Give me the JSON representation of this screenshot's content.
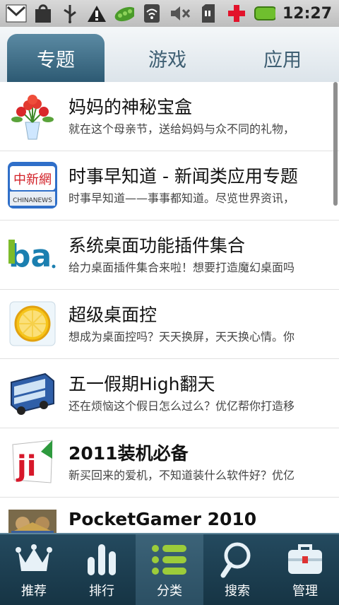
{
  "status": {
    "time": "12:27",
    "icons": [
      "gmail-icon",
      "bag-icon",
      "usb-icon",
      "warning-icon",
      "pea-pod-icon",
      "wifi-icon",
      "mute-icon",
      "sd-card-icon",
      "plus-icon",
      "battery-icon"
    ]
  },
  "tabs": [
    {
      "label": "专题",
      "active": true
    },
    {
      "label": "游戏",
      "active": false
    },
    {
      "label": "应用",
      "active": false
    }
  ],
  "items": [
    {
      "title": "妈妈的神秘宝盒",
      "desc": "就在这个母亲节，送给妈妈与众不同的礼物，",
      "icon": "flowers-icon",
      "bold": false
    },
    {
      "title": "时事早知道 - 新闻类应用专题",
      "desc": "时事早知道——事事都知道。尽览世界资讯，",
      "icon": "chinanews-icon",
      "bold": false
    },
    {
      "title": "系统桌面功能插件集合",
      "desc": "给力桌面插件集合来啦！想要打造魔幻桌面吗",
      "icon": "ba-icon",
      "bold": false
    },
    {
      "title": "超级桌面控",
      "desc": "想成为桌面控吗？天天换屏，天天换心情。你",
      "icon": "lemon-ice-icon",
      "bold": false
    },
    {
      "title": "五一假期High翻天",
      "desc": "还在烦恼这个假日怎么过么？优亿帮你打造移",
      "icon": "bus-icon",
      "bold": false
    },
    {
      "title": "2011装机必备",
      "desc": "新买回来的爱机，不知道装什么软件好？优亿",
      "icon": "ji-icon",
      "bold": true
    },
    {
      "title": "PocketGamer 2010",
      "desc": "",
      "icon": "pocketgamer-icon",
      "bold": true
    }
  ],
  "thumb_labels": {
    "chinanews_cn": "中新網",
    "chinanews_en": "CHINANEWS",
    "ba": "ba",
    "ji": "ji"
  },
  "bottom_nav": [
    {
      "label": "推荐",
      "icon": "crown-icon",
      "active": false
    },
    {
      "label": "排行",
      "icon": "bars-icon",
      "active": false
    },
    {
      "label": "分类",
      "icon": "list-icon",
      "active": true
    },
    {
      "label": "搜索",
      "icon": "magnifier-icon",
      "active": false
    },
    {
      "label": "管理",
      "icon": "toolbox-icon",
      "active": false
    }
  ],
  "colors": {
    "accent": "#2d5a73",
    "nav_bg": "#1b3b4d",
    "green_icon": "#9ccc3a"
  }
}
